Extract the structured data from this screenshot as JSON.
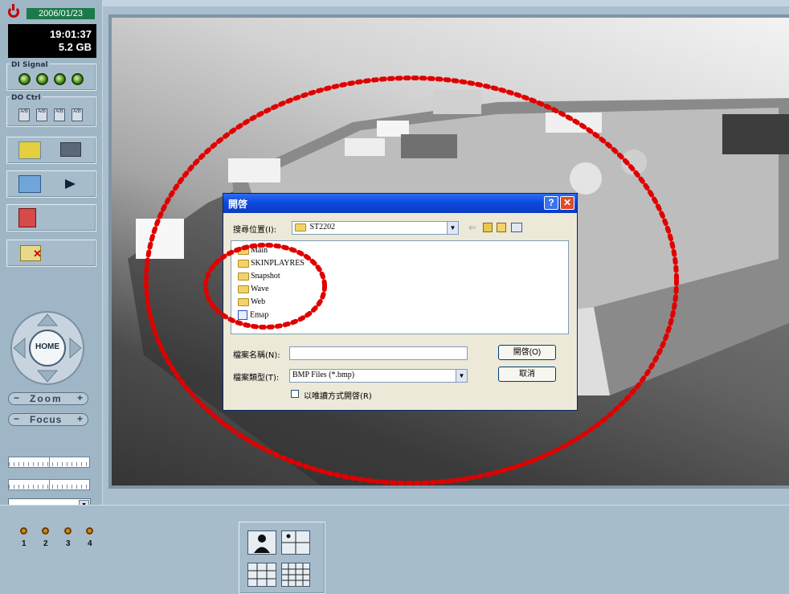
{
  "status": {
    "date": "2006/01/23",
    "time": "19:01:37",
    "storage": "5.2 GB"
  },
  "sections": {
    "di_signal": "DI Signal",
    "do_ctrl": "DO Ctrl"
  },
  "do_icon_label": "A/B",
  "ptz": {
    "home_label": "HOME",
    "zoom_label": "Zoom",
    "focus_label": "Focus"
  },
  "dialog": {
    "title": "開啓",
    "look_in_label": "搜尋位置(I):",
    "look_in_value": "ST2202",
    "file_name_label": "檔案名稱(N):",
    "file_name_value": "",
    "file_type_label": "檔案類型(T):",
    "file_type_value": "BMP Files (*.bmp)",
    "readonly_label": "以唯讀方式開啓(R)",
    "open_button": "開啓(O)",
    "cancel_button": "取消",
    "files": [
      {
        "name": "Main",
        "type": "folder"
      },
      {
        "name": "SKINPLAYRES",
        "type": "folder"
      },
      {
        "name": "Snapshot",
        "type": "folder"
      },
      {
        "name": "Wave",
        "type": "folder"
      },
      {
        "name": "Web",
        "type": "folder"
      },
      {
        "name": "Emap",
        "type": "image"
      }
    ]
  },
  "cameras": [
    "1",
    "2",
    "3",
    "4"
  ],
  "colors": {
    "panel": "#9fb6c6",
    "annotation": "#e00000",
    "title_bar": "#0a4ae0"
  }
}
